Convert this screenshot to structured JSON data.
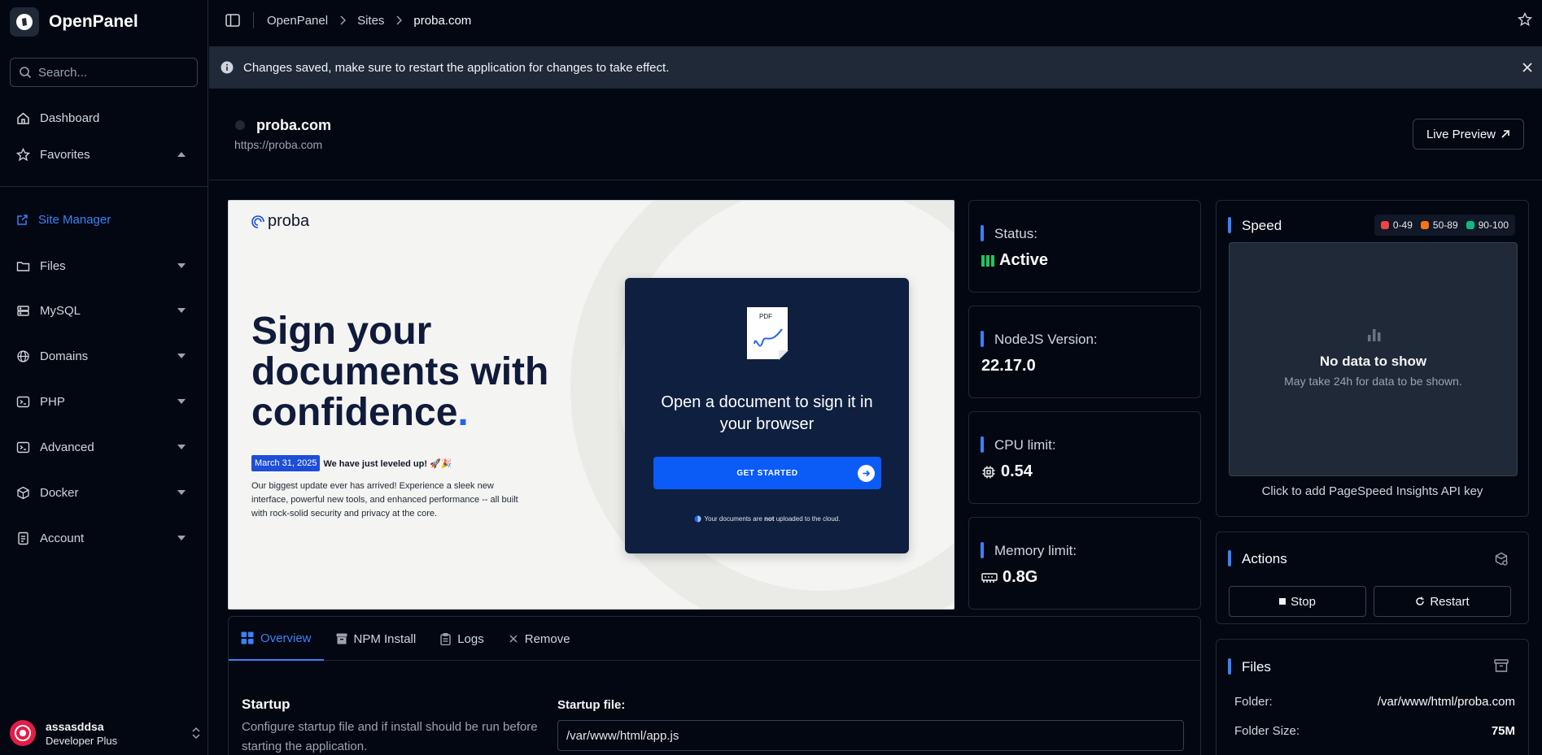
{
  "app": {
    "name": "OpenPanel"
  },
  "sidebar": {
    "search_placeholder": "Search...",
    "items": [
      {
        "label": "Dashboard"
      },
      {
        "label": "Favorites"
      },
      {
        "label": "Site Manager"
      },
      {
        "label": "Files"
      },
      {
        "label": "MySQL"
      },
      {
        "label": "Domains"
      },
      {
        "label": "PHP"
      },
      {
        "label": "Advanced"
      },
      {
        "label": "Docker"
      },
      {
        "label": "Account"
      }
    ],
    "user": {
      "name": "assasddsa",
      "plan": "Developer Plus"
    }
  },
  "breadcrumb": [
    "OpenPanel",
    "Sites",
    "proba.com"
  ],
  "alert": {
    "text": "Changes saved, make sure to restart the application for changes to take effect."
  },
  "site": {
    "title": "proba.com",
    "url": "https://proba.com",
    "live_preview": "Live Preview"
  },
  "preview": {
    "logo": "proba",
    "headline": "Sign your documents with confidence",
    "headline_dot": ".",
    "date_badge": "March 31, 2025",
    "date_text": "We have just leveled up! 🚀🎉",
    "paragraph": "Our biggest update ever has arrived! Experience a sleek new interface, powerful new tools, and enhanced performance -- all built with rock-solid security and privacy at the core.",
    "card_title": "Open a document to sign it in your browser",
    "card_button": "GET STARTED",
    "card_note_pre": "Your documents are ",
    "card_note_bold": "not",
    "card_note_post": " uploaded to the cloud.",
    "pdf_label": "PDF"
  },
  "stats": {
    "status": {
      "label": "Status:",
      "value": "Active"
    },
    "node": {
      "label": "NodeJS Version:",
      "value": "22.17.0"
    },
    "cpu": {
      "label": "CPU limit:",
      "value": "0.54"
    },
    "memory": {
      "label": "Memory limit:",
      "value": "0.8G"
    }
  },
  "speed": {
    "title": "Speed",
    "legend": [
      {
        "label": "0-49",
        "color": "#ef4444"
      },
      {
        "label": "50-89",
        "color": "#f97316"
      },
      {
        "label": "90-100",
        "color": "#10b981"
      }
    ],
    "empty_title": "No data to show",
    "empty_sub": "May take 24h for data to be shown.",
    "footer": "Click to add PageSpeed Insights API key"
  },
  "actions": {
    "title": "Actions",
    "stop": "Stop",
    "restart": "Restart"
  },
  "files": {
    "title": "Files",
    "folder_label": "Folder:",
    "folder_value": "/var/www/html/proba.com",
    "size_label": "Folder Size:",
    "size_value": "75M"
  },
  "tabs": [
    {
      "label": "Overview"
    },
    {
      "label": "NPM Install"
    },
    {
      "label": "Logs"
    },
    {
      "label": "Remove"
    }
  ],
  "startup": {
    "title": "Startup",
    "description": "Configure startup file and if install should be run before starting the application.",
    "file_label": "Startup file:",
    "file_value": "/var/www/html/app.js"
  },
  "colors": {
    "accent": "#3b82f6",
    "active": "#22c55e"
  }
}
